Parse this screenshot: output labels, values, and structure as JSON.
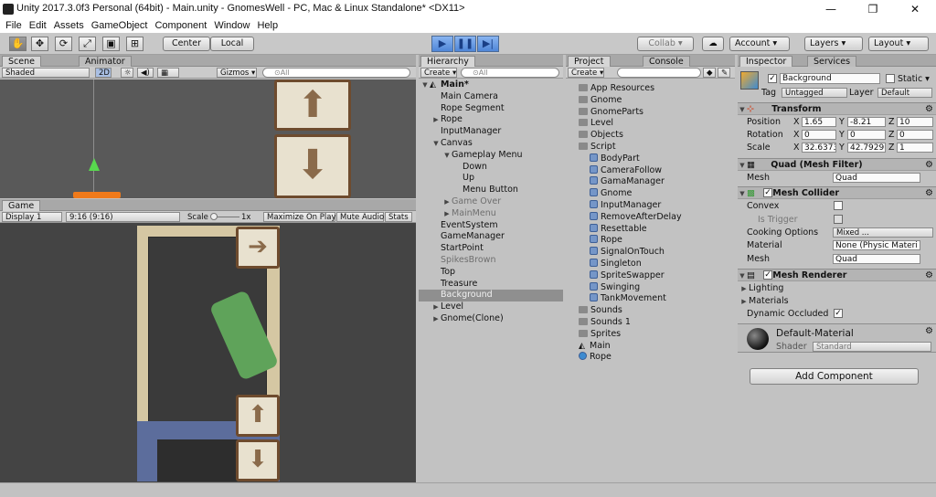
{
  "window": {
    "title": "Unity 2017.3.0f3 Personal (64bit) - Main.unity - GnomesWell - PC, Mac & Linux Standalone* <DX11>",
    "minimize": "—",
    "maximize": "❐",
    "close": "✕"
  },
  "menu": [
    "File",
    "Edit",
    "Assets",
    "GameObject",
    "Component",
    "Window",
    "Help"
  ],
  "toolbar": {
    "tools": [
      "✋",
      "✥",
      "⟳",
      "⤢",
      "▣",
      "⊞"
    ],
    "pivot": "Center",
    "space": "Local",
    "play": "▶",
    "pause": "❚❚",
    "step": "▶|",
    "collab": "Collab ▾",
    "cloud": "☁",
    "account": "Account ▾",
    "layers": "Layers ▾",
    "layout": "Layout ▾"
  },
  "scene": {
    "tab_scene": "Scene",
    "tab_animator": "Animator",
    "shaded": "Shaded",
    "mode2d": "2D",
    "light": "☼",
    "audio": "◀)",
    "fx": "▦",
    "gizmos": "Gizmos ▾",
    "search_placeholder": "⊙All"
  },
  "game": {
    "tab": "Game",
    "display": "Display 1",
    "aspect": "9:16 (9:16)",
    "scale_label": "Scale",
    "scale_value": "1x",
    "maximize": "Maximize On Play",
    "mute": "Mute Audio",
    "stats": "Stats"
  },
  "hierarchy": {
    "tab": "Hierarchy",
    "create": "Create ▾",
    "search_placeholder": "⊙All",
    "scene": "Main*",
    "items": [
      {
        "label": "Main Camera",
        "arrow": "",
        "depth": 1
      },
      {
        "label": "Rope Segment",
        "arrow": "",
        "depth": 1
      },
      {
        "label": "Rope",
        "arrow": "▶",
        "depth": 1
      },
      {
        "label": "InputManager",
        "arrow": "",
        "depth": 1
      },
      {
        "label": "Canvas",
        "arrow": "▼",
        "depth": 1
      },
      {
        "label": "Gameplay Menu",
        "arrow": "▼",
        "depth": 2
      },
      {
        "label": "Down",
        "arrow": "",
        "depth": 3
      },
      {
        "label": "Up",
        "arrow": "",
        "depth": 3
      },
      {
        "label": "Menu Button",
        "arrow": "",
        "depth": 3
      },
      {
        "label": "Game Over",
        "arrow": "▶",
        "depth": 2,
        "dim": true
      },
      {
        "label": "MainMenu",
        "arrow": "▶",
        "depth": 2,
        "dim": true
      },
      {
        "label": "EventSystem",
        "arrow": "",
        "depth": 1
      },
      {
        "label": "GameManager",
        "arrow": "",
        "depth": 1
      },
      {
        "label": "StartPoint",
        "arrow": "",
        "depth": 1
      },
      {
        "label": "SpikesBrown",
        "arrow": "",
        "depth": 1,
        "dim": true
      },
      {
        "label": "Top",
        "arrow": "",
        "depth": 1
      },
      {
        "label": "Treasure",
        "arrow": "",
        "depth": 1
      },
      {
        "label": "Background",
        "arrow": "",
        "depth": 1,
        "selected": true
      },
      {
        "label": "Level",
        "arrow": "▶",
        "depth": 1
      },
      {
        "label": "Gnome(Clone)",
        "arrow": "▶",
        "depth": 1
      }
    ]
  },
  "project": {
    "tab_project": "Project",
    "tab_console": "Console",
    "create": "Create ▾",
    "items": [
      {
        "label": "App Resources",
        "kind": "folder",
        "depth": 1
      },
      {
        "label": "Gnome",
        "kind": "folder",
        "depth": 1
      },
      {
        "label": "GnomeParts",
        "kind": "folder",
        "depth": 1
      },
      {
        "label": "Level",
        "kind": "folder",
        "depth": 1
      },
      {
        "label": "Objects",
        "kind": "folder",
        "depth": 1
      },
      {
        "label": "Script",
        "kind": "folder",
        "depth": 1
      },
      {
        "label": "BodyPart",
        "kind": "script",
        "depth": 2
      },
      {
        "label": "CameraFollow",
        "kind": "script",
        "depth": 2
      },
      {
        "label": "GamaManager",
        "kind": "script",
        "depth": 2
      },
      {
        "label": "Gnome",
        "kind": "script",
        "depth": 2
      },
      {
        "label": "InputManager",
        "kind": "script",
        "depth": 2
      },
      {
        "label": "RemoveAfterDelay",
        "kind": "script",
        "depth": 2
      },
      {
        "label": "Resettable",
        "kind": "script",
        "depth": 2
      },
      {
        "label": "Rope",
        "kind": "script",
        "depth": 2
      },
      {
        "label": "SignalOnTouch",
        "kind": "script",
        "depth": 2
      },
      {
        "label": "Singleton",
        "kind": "script",
        "depth": 2
      },
      {
        "label": "SpriteSwapper",
        "kind": "script",
        "depth": 2
      },
      {
        "label": "Swinging",
        "kind": "script",
        "depth": 2
      },
      {
        "label": "TankMovement",
        "kind": "script",
        "depth": 2
      },
      {
        "label": "Sounds",
        "kind": "folder",
        "depth": 1
      },
      {
        "label": "Sounds 1",
        "kind": "folder",
        "depth": 1
      },
      {
        "label": "Sprites",
        "kind": "folder",
        "depth": 1
      },
      {
        "label": "Main",
        "kind": "scene",
        "depth": 1
      },
      {
        "label": "Rope",
        "kind": "prefab",
        "depth": 1
      }
    ]
  },
  "inspector": {
    "tab_inspector": "Inspector",
    "tab_services": "Services",
    "object_name": "Background",
    "static_label": "Static ▾",
    "tag_label": "Tag",
    "tag_value": "Untagged",
    "layer_label": "Layer",
    "layer_value": "Default",
    "transform": {
      "title": "Transform",
      "position_label": "Position",
      "rotation_label": "Rotation",
      "scale_label": "Scale",
      "position": {
        "x": "1.65",
        "y": "-8.21",
        "z": "10"
      },
      "rotation": {
        "x": "0",
        "y": "0",
        "z": "0"
      },
      "scale": {
        "x": "32.6373",
        "y": "42.7929",
        "z": "1"
      },
      "x": "X",
      "y": "Y",
      "z": "Z"
    },
    "mesh_filter": {
      "title": "Quad (Mesh Filter)",
      "mesh_label": "Mesh",
      "mesh_value": "Quad"
    },
    "mesh_collider": {
      "title": "Mesh Collider",
      "convex": "Convex",
      "is_trigger": "Is Trigger",
      "cooking": "Cooking Options",
      "cooking_value": "Mixed ...",
      "material": "Material",
      "material_value": "None (Physic Materi",
      "mesh_label": "Mesh",
      "mesh_value": "Quad"
    },
    "mesh_renderer": {
      "title": "Mesh Renderer",
      "lighting": "Lighting",
      "materials": "Materials",
      "dynamic_occluded": "Dynamic Occluded"
    },
    "material": {
      "name": "Default-Material",
      "shader_label": "Shader",
      "shader_value": "Standard"
    },
    "add_component": "Add Component"
  },
  "colors": {
    "accent": "#4f86d8",
    "selected": "#8f8f8f",
    "orange": "#f07a1a"
  }
}
